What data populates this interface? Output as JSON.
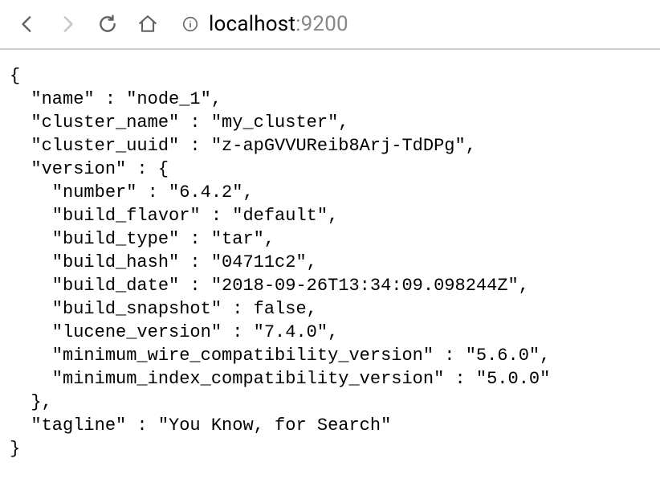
{
  "address": {
    "host": "localhost",
    "port": ":9200"
  },
  "response": {
    "name": "node_1",
    "cluster_name": "my_cluster",
    "cluster_uuid": "z-apGVVUReib8Arj-TdDPg",
    "version": {
      "number": "6.4.2",
      "build_flavor": "default",
      "build_type": "tar",
      "build_hash": "04711c2",
      "build_date": "2018-09-26T13:34:09.098244Z",
      "build_snapshot": false,
      "lucene_version": "7.4.0",
      "minimum_wire_compatibility_version": "5.6.0",
      "minimum_index_compatibility_version": "5.0.0"
    },
    "tagline": "You Know, for Search"
  }
}
